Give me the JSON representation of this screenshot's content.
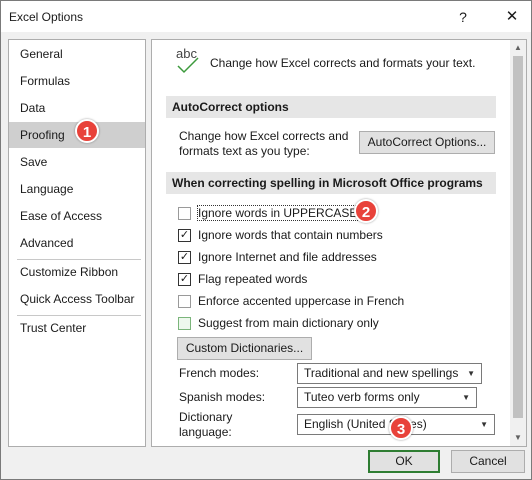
{
  "window": {
    "title": "Excel Options",
    "help": "?",
    "close": "✕"
  },
  "nav": {
    "items": [
      {
        "label": "General"
      },
      {
        "label": "Formulas"
      },
      {
        "label": "Data"
      },
      {
        "label": "Proofing"
      },
      {
        "label": "Save"
      },
      {
        "label": "Language"
      },
      {
        "label": "Ease of Access"
      },
      {
        "label": "Advanced"
      },
      {
        "label": "Customize Ribbon"
      },
      {
        "label": "Quick Access Toolbar"
      },
      {
        "label": "Trust Center"
      }
    ],
    "active": "Proofing"
  },
  "header": {
    "icon_text": "abc",
    "text": "Change how Excel corrects and formats your text."
  },
  "autocorrect": {
    "section_title": "AutoCorrect options",
    "description_line1": "Change how Excel corrects and",
    "description_line2": "formats text as you type:",
    "button": "AutoCorrect Options..."
  },
  "spelling": {
    "section_title": "When correcting spelling in Microsoft Office programs",
    "options": [
      {
        "label": "Ignore words in UPPERCASE",
        "checked": false
      },
      {
        "label": "Ignore words that contain numbers",
        "checked": true
      },
      {
        "label": "Ignore Internet and file addresses",
        "checked": true
      },
      {
        "label": "Flag repeated words",
        "checked": true
      },
      {
        "label": "Enforce accented uppercase in French",
        "checked": false
      },
      {
        "label": "Suggest from main dictionary only",
        "checked": false
      }
    ],
    "custom_dict_button": "Custom Dictionaries...",
    "french_modes_label": "French modes:",
    "french_modes_value": "Traditional and new spellings",
    "spanish_modes_label": "Spanish modes:",
    "spanish_modes_value": "Tuteo verb forms only",
    "dictionary_label_line1": "Dictionary",
    "dictionary_label_line2": "language:",
    "dictionary_value": "English (United States)"
  },
  "footer": {
    "ok": "OK",
    "cancel": "Cancel"
  },
  "callouts": [
    "1",
    "2",
    "3"
  ],
  "colors": {
    "callout": "#e8423a",
    "active_nav": "#cfcfcf",
    "ok_border": "#2e7d32"
  }
}
